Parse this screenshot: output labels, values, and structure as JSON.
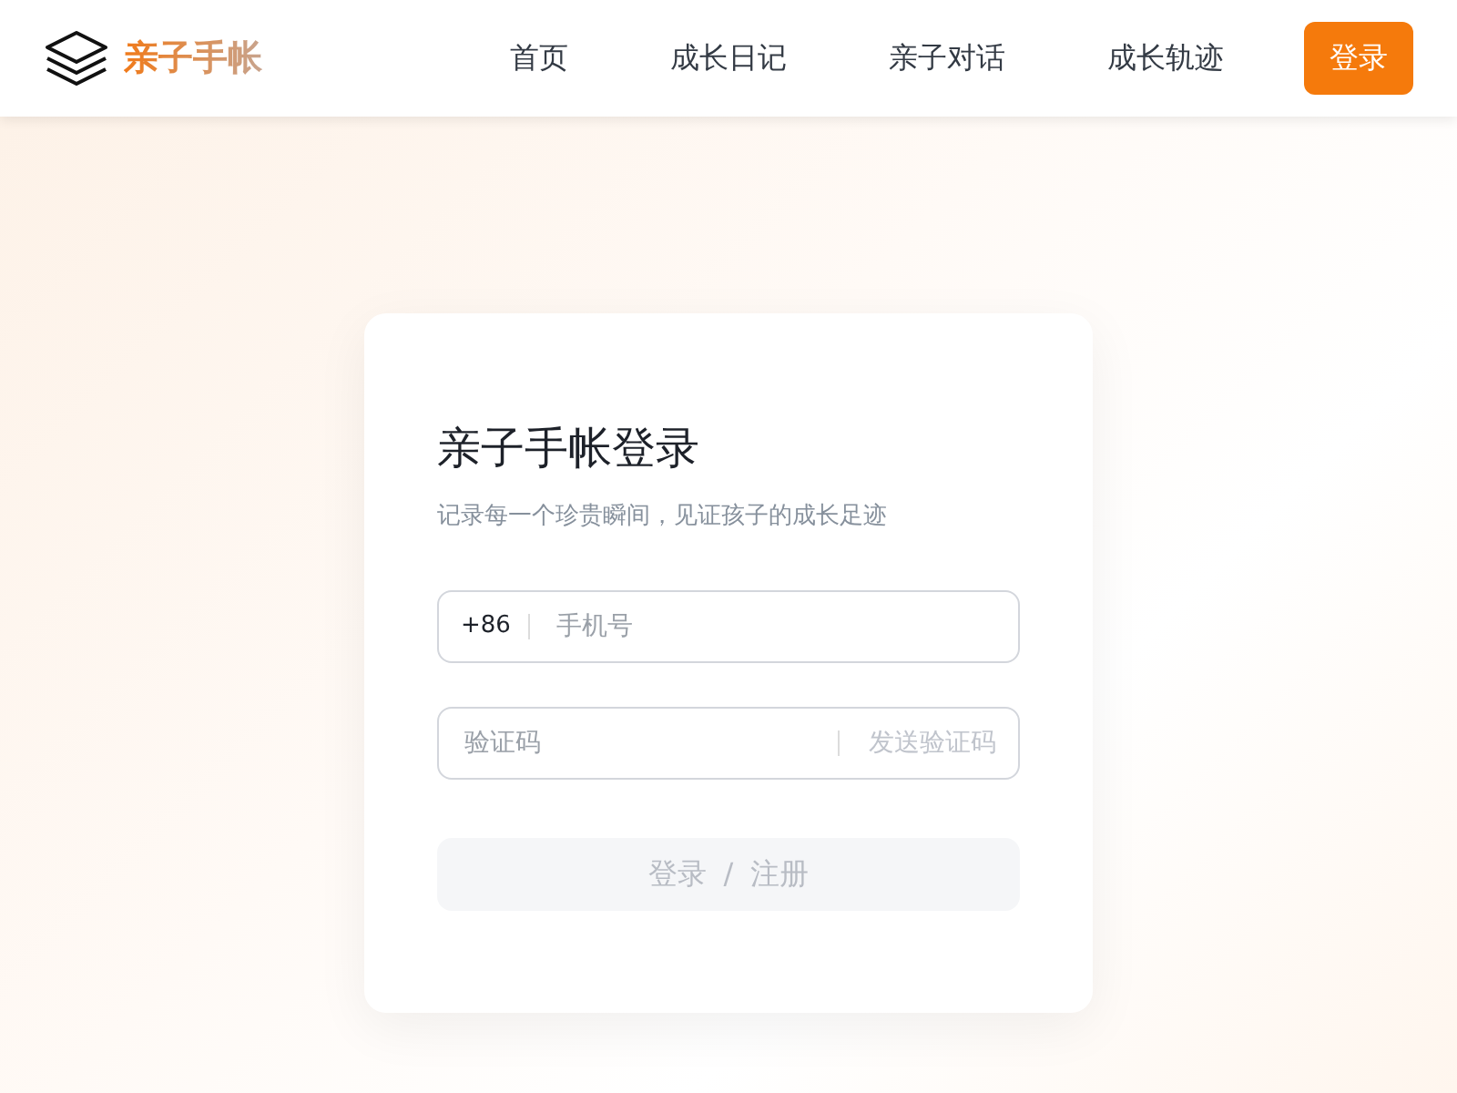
{
  "header": {
    "logo_text": "亲子手帐",
    "nav": [
      {
        "label": "首页"
      },
      {
        "label": "成长日记"
      },
      {
        "label": "亲子对话"
      },
      {
        "label": "成长轨迹"
      }
    ],
    "login_button": "登录"
  },
  "login_card": {
    "title": "亲子手帐登录",
    "subtitle": "记录每一个珍贵瞬间，见证孩子的成长足迹",
    "phone_field": {
      "prefix": "+86",
      "placeholder": "手机号"
    },
    "code_field": {
      "placeholder": "验证码",
      "send_code": {
        "label": "发送验证码",
        "disabled": true
      }
    },
    "submit": {
      "label": "登录 / 注册",
      "disabled": true
    }
  }
}
